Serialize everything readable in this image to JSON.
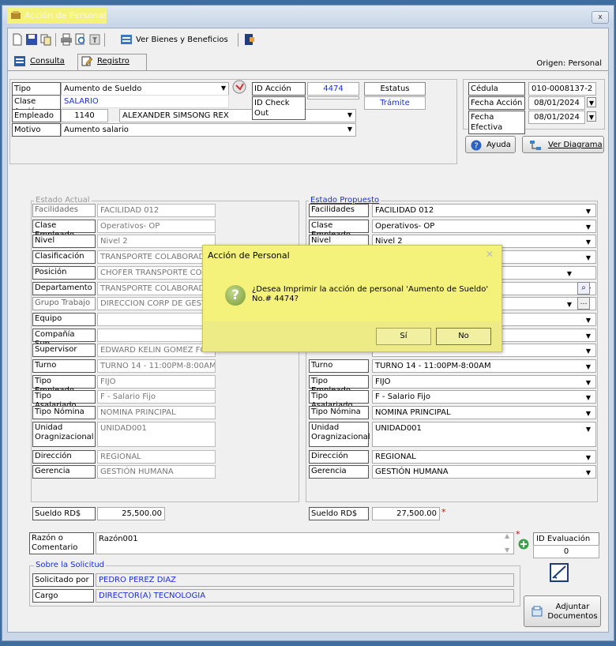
{
  "window": {
    "title": "Acción de Personal",
    "close_label": "x"
  },
  "toolbar": {
    "beneficios_label": "Ver Bienes y Beneficios"
  },
  "tabs": [
    {
      "label": "Consulta"
    },
    {
      "label": "Registro"
    }
  ],
  "origen": "Origen: Personal",
  "header": {
    "tipo_accion_label": "Tipo Acción",
    "tipo_accion_value": "Aumento de Sueldo",
    "clase_accion_label": "Clase Acción",
    "clase_accion_value": "SALARIO",
    "empleado_label": "Empleado",
    "empleado_id": "1140",
    "empleado_name": "ALEXANDER SIMSONG REX",
    "motivo_label": "Motivo",
    "motivo_value": "Aumento salario",
    "id_accion_label": "ID Acción",
    "id_accion_value": "4474",
    "id_checkout_label": "ID Check Out",
    "id_checkout_value": "",
    "estatus_label": "Estatus",
    "estatus_value": "Trámite",
    "cedula_label": "Cédula",
    "cedula_value": "010-0008137-2",
    "fecha_accion_label": "Fecha Acción",
    "fecha_accion_value": "08/01/2024",
    "fecha_efectiva_label": "Fecha Efectiva",
    "fecha_efectiva_value": "08/01/2024",
    "ayuda_label": "Ayuda",
    "diagrama_label": "Ver Diagrama"
  },
  "actual": {
    "title": "Estado Actual",
    "rows": [
      {
        "label": "Facilidades",
        "value": "FACILIDAD 012"
      },
      {
        "label": "Clase Empleado",
        "value": "Operativos- OP"
      },
      {
        "label": "Nivel",
        "value": "Nivel 2"
      },
      {
        "label": "Clasificación",
        "value": "TRANSPORTE COLABORADO"
      },
      {
        "label": "Posición",
        "value": "CHOFER TRANSPORTE COL"
      },
      {
        "label": "Departamento",
        "value": "TRANSPORTE COLABORADO"
      },
      {
        "label": "Grupo Trabajo",
        "value": "DIRECCION CORP DE GESTI"
      },
      {
        "label": "Equipo",
        "value": ""
      },
      {
        "label": "Compañía Sup.",
        "value": ""
      },
      {
        "label": "Supervisor",
        "value": "EDWARD KELIN GOMEZ FO"
      },
      {
        "label": "Turno",
        "value": "TURNO 14 - 11:00PM-8:00AM"
      },
      {
        "label": "Tipo Empleado",
        "value": "FIJO"
      },
      {
        "label": "Tipo Asalariado",
        "value": "F - Salario Fijo"
      },
      {
        "label": "Tipo Nómina",
        "value": "NOMINA PRINCIPAL"
      },
      {
        "label": "Unidad Oragnizacional",
        "value": "UNIDAD001"
      },
      {
        "label": "Dirección",
        "value": "REGIONAL"
      },
      {
        "label": "Gerencia",
        "value": "GESTIÓN HUMANA"
      }
    ],
    "sueldo_label": "Sueldo RD$",
    "sueldo_value": "25,500.00"
  },
  "propuesto": {
    "title": "Estado Propuesto",
    "rows": [
      {
        "label": "Facilidades",
        "value": "FACILIDAD 012"
      },
      {
        "label": "Clase Empleado",
        "value": "Operativos- OP"
      },
      {
        "label": "Nivel",
        "value": "Nivel 2"
      },
      {
        "label": "",
        "value": ""
      },
      {
        "label": "",
        "value": "ADORES"
      },
      {
        "label": "",
        "value": ""
      },
      {
        "label": "",
        "value": "UMANA"
      },
      {
        "label": "",
        "value": ""
      },
      {
        "label": "",
        "value": ""
      },
      {
        "label": "",
        "value": ""
      },
      {
        "label": "Turno",
        "value": "TURNO 14 - 11:00PM-8:00AM"
      },
      {
        "label": "Tipo Empleado",
        "value": "FIJO"
      },
      {
        "label": "Tipo Asalariado",
        "value": "F - Salario Fijo"
      },
      {
        "label": "Tipo Nómina",
        "value": "NOMINA PRINCIPAL"
      },
      {
        "label": "Unidad Oragnizacional",
        "value": "UNIDAD001"
      },
      {
        "label": "Dirección",
        "value": "REGIONAL"
      },
      {
        "label": "Gerencia",
        "value": "GESTIÓN HUMANA"
      }
    ],
    "sueldo_label": "Sueldo RD$",
    "sueldo_value": "27,500.00",
    "required_mark": "*"
  },
  "razon": {
    "label": "Razón o Comentario",
    "value": "Razón001"
  },
  "evaluacion": {
    "label": "ID Evaluación",
    "value": "0"
  },
  "solicitud": {
    "title": "Sobre la Solicitud",
    "solicitado_label": "Solicitado por",
    "solicitado_value": "PEDRO PEREZ DIAZ",
    "cargo_label": "Cargo",
    "cargo_value": "DIRECTOR(A) TECNOLOGIA"
  },
  "adjuntar_label": "Adjuntar Documentos",
  "dialog": {
    "title": "Acción de Personal",
    "message": "¿Desea Imprimir la acción de personal 'Aumento de Sueldo' No.# 4474?",
    "yes_label": "Sí",
    "no_label": "No"
  }
}
